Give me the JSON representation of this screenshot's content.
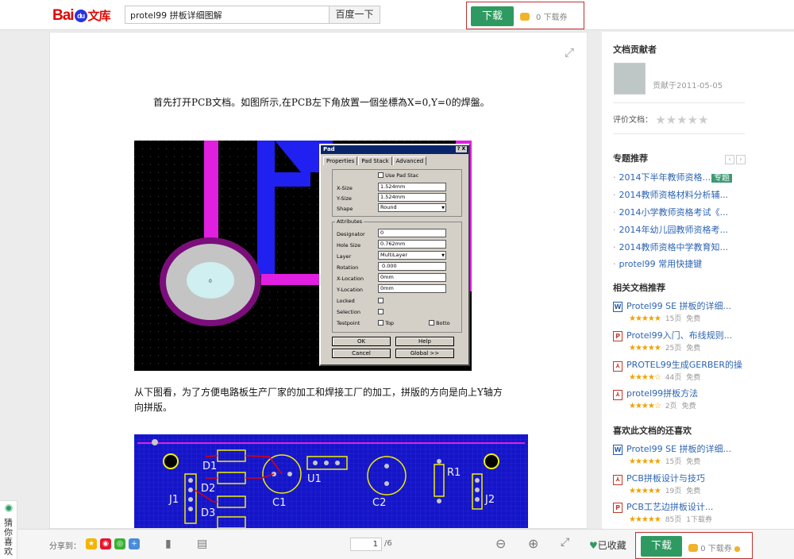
{
  "header": {
    "logo_bai": "Bai",
    "logo_du": "du",
    "logo_wenku": "文库",
    "search_value": "protel99 拼板详细图解",
    "search_button": "百度一下",
    "download_button": "下载",
    "download_coupon": "0 下载券"
  },
  "document": {
    "para1": "首先打开PCB文档。如图所示,在PCB左下角放置一個坐標為X=0,Y=0的焊盤。",
    "para2": "从下图看，为了方便电路板生产厂家的加工和焊接工厂的加工，拼版的方向是向上Y轴方向拼版。",
    "pad_dialog": {
      "title": "Pad",
      "title_btns": "? X",
      "tabs": [
        "Properties",
        "Pad Stack",
        "Advanced"
      ],
      "use_pad_stack": "Use Pad Stac",
      "xsize_label": "X-Size",
      "xsize": "1.524mm",
      "ysize_label": "Y-Size",
      "ysize": "1.524mm",
      "shape_label": "Shape",
      "shape": "Round",
      "attributes": "Attributes",
      "designator_label": "Designator",
      "designator": "0",
      "hole_label": "Hole Size",
      "hole": "0.762mm",
      "layer_label": "Layer",
      "layer": "MultiLayer",
      "rotation_label": "Rotation",
      "rotation": "0.000",
      "xloc_label": "X-Location",
      "xloc": "0mm",
      "yloc_label": "Y-Location",
      "yloc": "0mm",
      "locked": "Locked",
      "selection": "Selection",
      "testpoint": "Testpoint",
      "top": "Top",
      "bottom": "Botto",
      "ok": "OK",
      "help": "Help",
      "cancel": "Cancel",
      "global": "Global >>"
    },
    "pad_label": "0",
    "pcb_labels": [
      "D1",
      "D2",
      "D3",
      "C1",
      "U1",
      "C2",
      "R1",
      "J1",
      "J2"
    ]
  },
  "sidebar": {
    "contributor_title": "文档贡献者",
    "contributed_on": "贡献于2011-05-05",
    "rating_label": "评价文档：",
    "rating_stars": "★★★★★",
    "topics_title": "专题推荐",
    "topics": [
      "2014下半年教师资格...",
      "2014教师资格材料分析辅...",
      "2014小学教师资格考试《...",
      "2014年幼儿园教师资格考...",
      "2014教师资格中学教育知...",
      "protel99 常用快捷键"
    ],
    "topic_tag": "专题",
    "related_title": "相关文档推荐",
    "related": [
      {
        "icon": "W",
        "title": "Protel99 SE 拼板的详细...",
        "stars": "★★★★★",
        "pages": "15页",
        "cost": "免费"
      },
      {
        "icon": "P",
        "title": "Protel99入门、布线规则...",
        "stars": "★★★★★",
        "pages": "25页",
        "cost": "免费"
      },
      {
        "icon": "PDF",
        "title": "PROTEL99生成GERBER的操",
        "stars": "★★★★☆",
        "pages": "44页",
        "cost": "免费"
      },
      {
        "icon": "PDF",
        "title": "protel99拼板方法",
        "stars": "★★★★☆",
        "pages": "2页",
        "cost": "免费"
      }
    ],
    "also_like_title": "喜欢此文档的还喜欢",
    "also_like": [
      {
        "icon": "W",
        "title": "Protel99 SE 拼板的详细...",
        "stars": "★★★★★",
        "pages": "15页",
        "cost": "免费"
      },
      {
        "icon": "PDF",
        "title": "PCB拼板设计与技巧",
        "stars": "★★★★★",
        "pages": "19页",
        "cost": "免费"
      },
      {
        "icon": "P",
        "title": "PCB工艺边拼板设计...",
        "stars": "★★★★★",
        "pages": "85页",
        "cost": "1下载券"
      }
    ]
  },
  "guess": "猜你喜欢",
  "bottom": {
    "share_label": "分享到：",
    "page_current": "1",
    "page_total": "/6",
    "favorite": "已收藏",
    "download_button": "下载",
    "download_coupon": "0 下载券"
  },
  "colors": {
    "download_green": "#2e9a61",
    "highlight_red": "#c03030",
    "link_blue": "#2d64b3"
  }
}
